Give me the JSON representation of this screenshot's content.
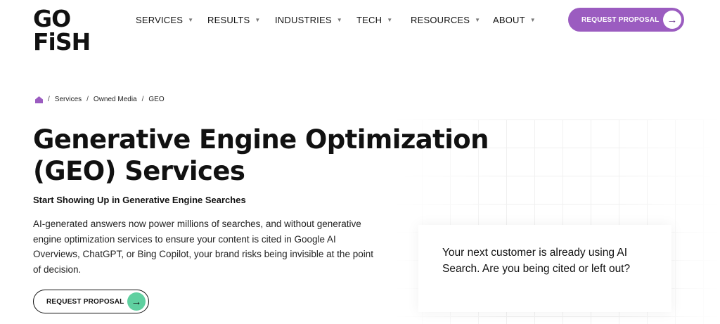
{
  "brand": {
    "logo_line1": "GO",
    "logo_line2": "FiSH",
    "accent": "#9b5cc0",
    "cta_arrow_green": "#5fd0a0"
  },
  "nav": {
    "items": [
      {
        "label": "SERVICES"
      },
      {
        "label": "RESULTS"
      },
      {
        "label": "INDUSTRIES"
      },
      {
        "label": "TECH"
      },
      {
        "label": "RESOURCES"
      },
      {
        "label": "ABOUT"
      }
    ],
    "cta_label": "REQUEST PROPOSAL",
    "cta_icon": "arrow-right-icon"
  },
  "breadcrumb": {
    "home_icon": "home-icon",
    "items": [
      "Services",
      "Owned Media",
      "GEO"
    ]
  },
  "hero": {
    "title": "Generative Engine Optimization (GEO) Services",
    "subtitle": "Start Showing Up in Generative Engine Searches",
    "description": "AI-generated answers now power millions of searches, and without generative engine optimization services to ensure your content is cited in Google AI Overviews, ChatGPT, or Bing Copilot, your brand risks being invisible at the point of decision.",
    "cta_label": "REQUEST PROPOSAL",
    "cta_icon": "arrow-right-icon"
  },
  "callout": {
    "text": "Your next customer is already using AI Search. Are you being cited or left out?"
  }
}
